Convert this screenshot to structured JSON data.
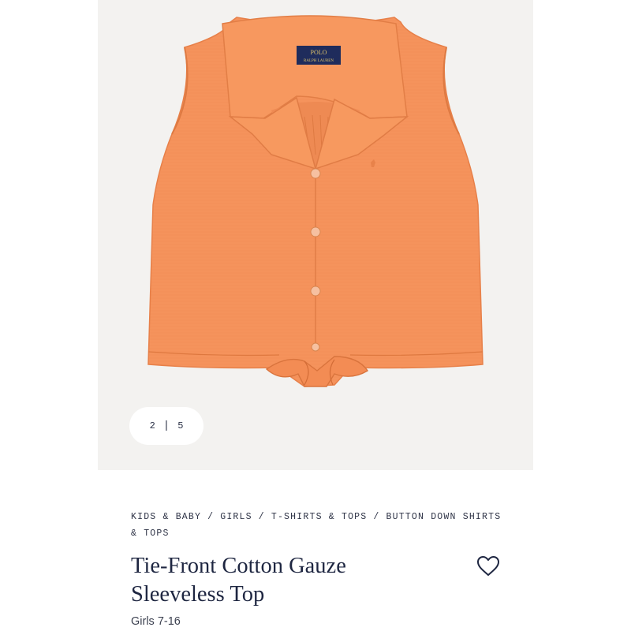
{
  "gallery": {
    "current_index": "2",
    "separator": "|",
    "total": "5",
    "logo": {
      "line1": "POLO",
      "line2": "RALPH LAUREN"
    }
  },
  "breadcrumb": {
    "items": [
      "KIDS & BABY",
      "GIRLS",
      "T-SHIRTS & TOPS",
      "BUTTON DOWN SHIRTS & TOPS"
    ],
    "separator": "/"
  },
  "product": {
    "title": "Tie-Front Cotton Gauze Sleeveless Top",
    "size_range": "Girls 7-16"
  },
  "colors": {
    "garment": "#f5935c",
    "garment_shadow": "#e07c45",
    "gallery_bg": "#f3f2f0",
    "text_navy": "#1e2641"
  },
  "icons": {
    "favorite": "heart-outline-icon"
  }
}
